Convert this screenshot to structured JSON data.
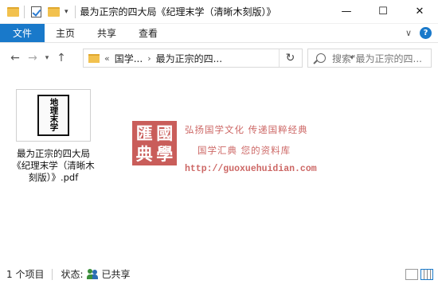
{
  "window": {
    "title": "最为正宗的四大局《纪理末学（清晰木刻版）》",
    "minimize": "—",
    "maximize": "☐",
    "close": "✕"
  },
  "ribbon": {
    "tabs": [
      "文件",
      "主页",
      "共享",
      "查看"
    ],
    "help": "?"
  },
  "nav": {
    "back": "←",
    "forward": "→",
    "recent": "▾",
    "up": "↑",
    "overflow": "«",
    "breadcrumb": [
      "国学...",
      "最为正宗的四..."
    ],
    "refresh": "↻",
    "search_placeholder": "搜索\"最为正宗的四..."
  },
  "files": [
    {
      "name": "最为正宗的四大局《纪理末学（清晰木刻版）》.pdf",
      "thumb_title": "地理末学"
    }
  ],
  "watermark": {
    "seal_chars": [
      "匯",
      "國",
      "典",
      "學"
    ],
    "line1": "弘扬国学文化  传递国粹经典",
    "line2": "国学汇典  您的资料库",
    "url": "http://guoxuehuidian.com"
  },
  "status": {
    "item_count": "1 个项目",
    "state_label": "状态:",
    "state_value": "已共享"
  },
  "colors": {
    "accent": "#1979ca",
    "folder": "#f2c14e",
    "watermark": "#c0413e"
  }
}
